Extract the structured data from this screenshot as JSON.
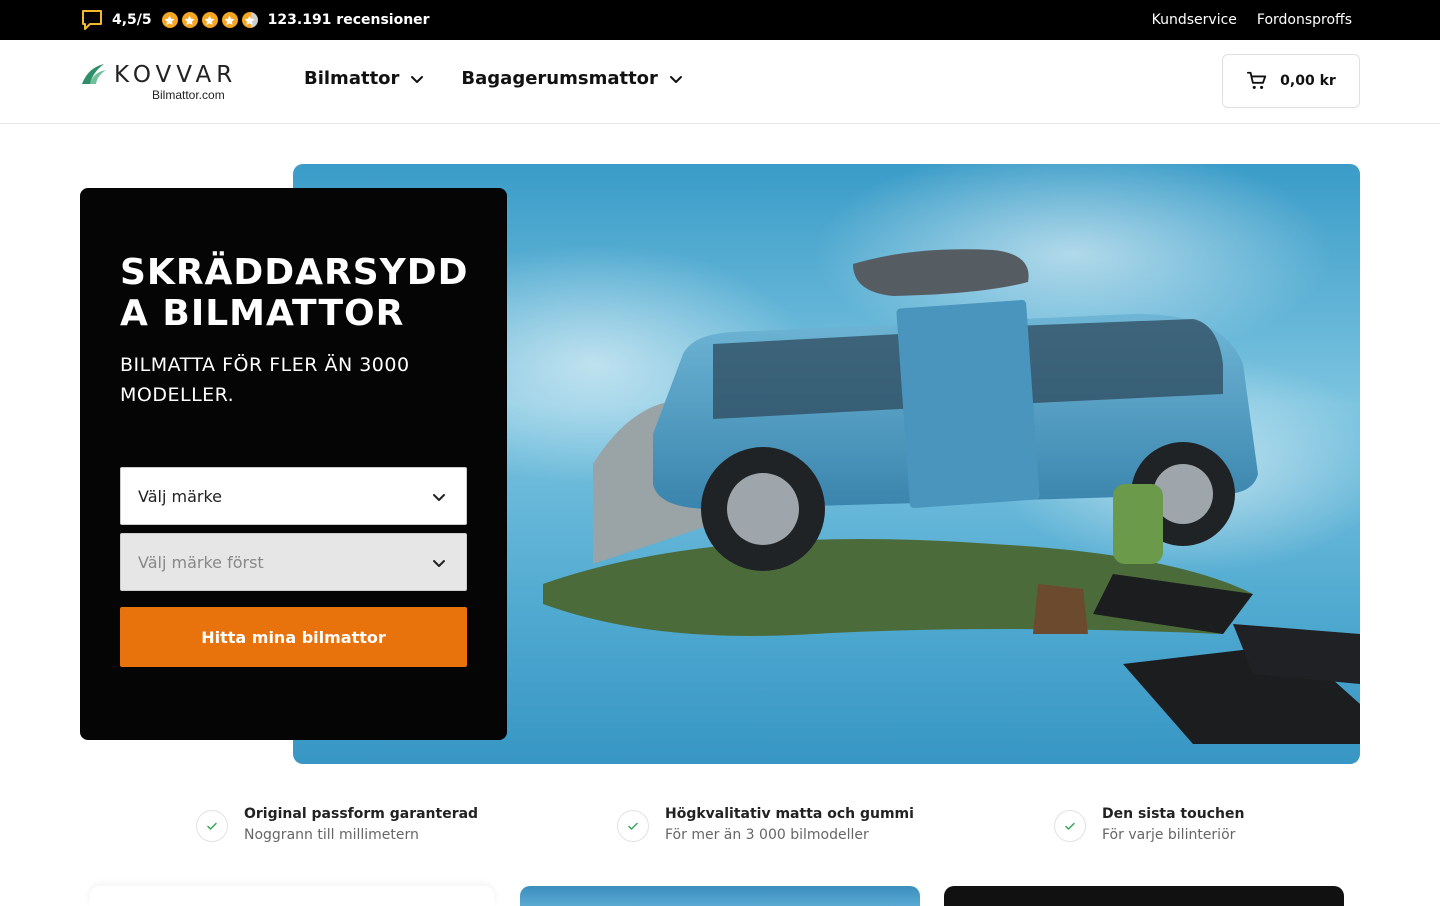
{
  "topbar": {
    "rating": "4,5/5",
    "stars": 4.5,
    "reviews": "123.191 recensioner",
    "links": [
      "Kundservice",
      "Fordonsproffs"
    ],
    "star_color": "#f5a623",
    "chat_icon": "chat-bubble-icon"
  },
  "header": {
    "logo": {
      "word": "KOVVAR",
      "sub": "Bilmattor.com"
    },
    "nav": [
      {
        "label": "Bilmattor"
      },
      {
        "label": "Bagagerumsmattor"
      }
    ],
    "cart": {
      "total": "0,00 kr",
      "icon": "cart-icon"
    }
  },
  "hero": {
    "title": "SKRÄDDARSYDDA BILMATTOR",
    "subtitle": "BILMATTA FÖR FLER ÄN 3000 MODELLER.",
    "brand_select": "Välj märke",
    "model_select": "Välj märke först",
    "cta": "Hitta mina bilmattor",
    "cta_color": "#e8720c"
  },
  "usps": [
    {
      "title": "Original passform garanterad",
      "sub": "Noggrann till millimetern"
    },
    {
      "title": "Högkvalitativ matta och gummi",
      "sub": "För mer än 3 000 bilmodeller"
    },
    {
      "title": "Den sista touchen",
      "sub": "För varje bilinteriör"
    }
  ]
}
